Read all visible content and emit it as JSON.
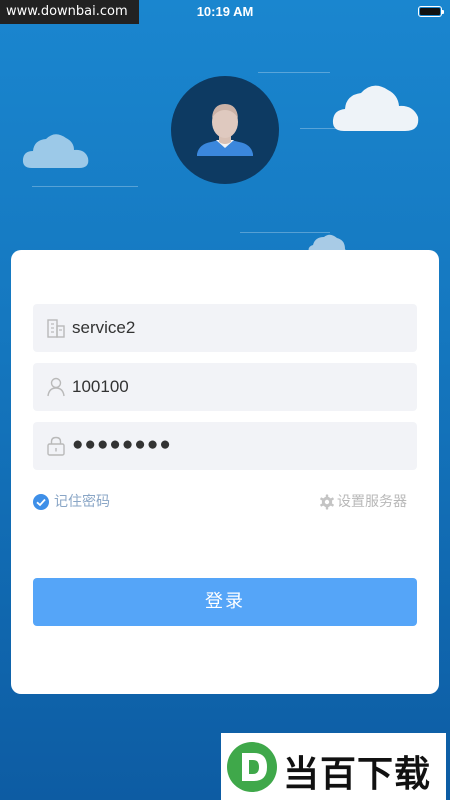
{
  "watermark_top": "www.downbai.com",
  "status_bar": {
    "time": "10:19 AM"
  },
  "form": {
    "server_value": "service2",
    "username_value": "100100",
    "password_value": "●●●●●●●●",
    "remember_label": "记住密码",
    "remember_checked": true,
    "server_settings_label": "设置服务器",
    "login_label": "登录"
  },
  "watermark_logo": {
    "letter": "D",
    "text": "当百下载"
  },
  "colors": {
    "accent": "#55a5f8",
    "check": "#3e8fe8",
    "background_top": "#1a86cf",
    "background_bottom": "#0d5ca3",
    "avatar_bg": "#0d3a62",
    "logo_green": "#3fa84a"
  },
  "icons": {
    "server_field": "building-icon",
    "username_field": "user-icon",
    "password_field": "lock-icon",
    "remember": "checkmark-icon",
    "server_settings": "gear-icon"
  }
}
